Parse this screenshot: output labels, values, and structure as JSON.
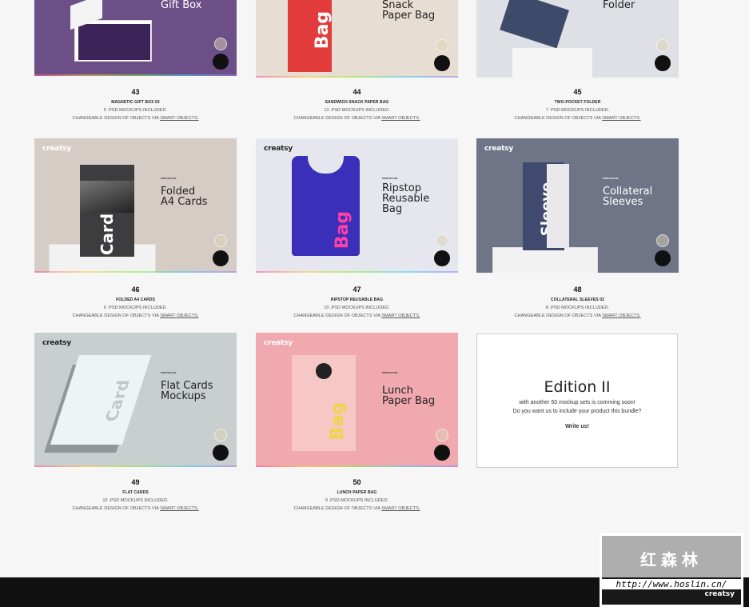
{
  "colors": {
    "background": "#f6f6f6",
    "footer": "#111111"
  },
  "top_titles": [
    "Gift Box",
    "Snack\nPaper Bag",
    "Folder"
  ],
  "cards": [
    {
      "num": "43",
      "name": "MAGNETIC GIFT BOX 02",
      "count": "5 .PSD MOCKUPS INCLUDED.",
      "changeable": "CHANGEABLE DESIGN OF OBJECTS VIA",
      "smart": "SMART OBJECTS.",
      "bg": "#6b4f86"
    },
    {
      "num": "44",
      "name": "SANDWICH SNACK PAPER BAG",
      "count": "13 .PSD MOCKUPS INCLUDED.",
      "changeable": "CHANGEABLE DESIGN OF OBJECTS VIA",
      "smart": "SMART OBJECTS.",
      "bg": "#e7ddd2"
    },
    {
      "num": "45",
      "name": "TWO-POCKET FOLDER",
      "count": "7 .PSD MOCKUPS INCLUDED.",
      "changeable": "CHANGEABLE DESIGN OF OBJECTS VIA",
      "smart": "SMART OBJECTS.",
      "bg": "#dfe0e6"
    },
    {
      "num": "46",
      "name": "FOLDED A4 CARDS",
      "count": "6 .PSD MOCKUPS INCLUDED.",
      "changeable": "CHANGEABLE DESIGN OF OBJECTS VIA",
      "smart": "SMART OBJECTS.",
      "bg": "#d6ccc6",
      "logo": "creatsy",
      "brand": "PRINTHOUSE",
      "title1": "Folded",
      "title2": "A4 Cards",
      "object": "Card"
    },
    {
      "num": "47",
      "name": "RIPSTOP REUSABLE  BAG",
      "count": "10 .PSD MOCKUPS INCLUDED.",
      "changeable": "CHANGEABLE DESIGN OF OBJECTS VIA",
      "smart": "SMART OBJECTS.",
      "bg": "#e6e7ee",
      "logo": "creatsy",
      "brand": "PRINTHOUSE",
      "title1": "Ripstop",
      "title2": "Reusable",
      "title3": "Bag",
      "object": "Bag"
    },
    {
      "num": "48",
      "name": "COLLATERAL SLEEVES 02",
      "count": "8 .PSD MOCKUPS INCLUDED.",
      "changeable": "CHANGEABLE DESIGN OF OBJECTS VIA",
      "smart": "SMART OBJECTS.",
      "bg": "#6f7586",
      "logo": "creatsy",
      "brand": "PRINTHOUSE",
      "title1": "Collateral",
      "title2": "Sleeves",
      "object": "Sleeve"
    },
    {
      "num": "49",
      "name": "FLAT CARDS",
      "count": "10 .PSD MOCKUPS INCLUDED.",
      "changeable": "CHANGEABLE DESIGN OF OBJECTS VIA",
      "smart": "SMART OBJECTS.",
      "bg": "#c9cfcf",
      "logo": "creatsy",
      "brand": "PRINTHOUSE",
      "title1": "Flat Cards",
      "title2": "Mockups",
      "object": "Card"
    },
    {
      "num": "50",
      "name": "LUNCH PAPER BAG",
      "count": "9 .PSD MOCKUPS INCLUDED.",
      "changeable": "CHANGEABLE DESIGN OF OBJECTS VIA",
      "smart": "SMART OBJECTS.",
      "bg": "#f0a9ae",
      "logo": "creatsy",
      "brand": "PRINTHOUSE",
      "title1": "Lunch",
      "title2": "Paper Bag",
      "object": "Bag"
    }
  ],
  "edition": {
    "title": "Edition II",
    "line1": "with another 50 mockup sets is comming soon!",
    "line2": "Do you want us to include your product this bundle?",
    "cta": "Write us!"
  },
  "watermark": {
    "chars": "红森林",
    "url": "http://www.hoslin.cn/",
    "brand": "creatsy"
  }
}
